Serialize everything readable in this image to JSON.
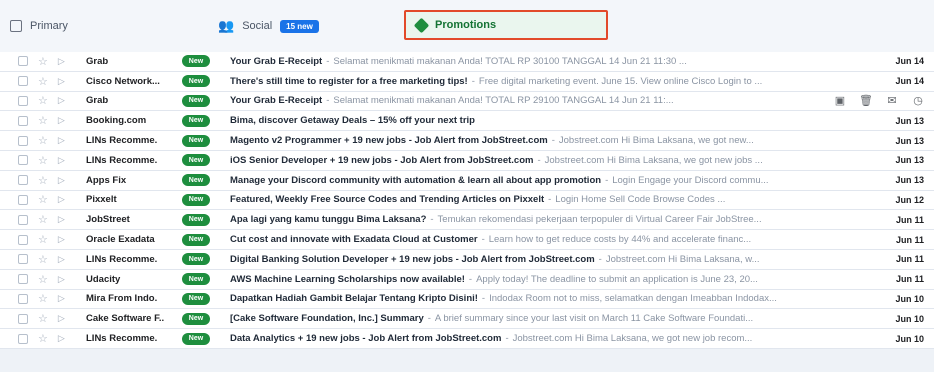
{
  "tabs": {
    "primary_label": "Primary",
    "social_label": "Social",
    "social_badge": "15 new",
    "promotions_label": "Promotions"
  },
  "rows": [
    {
      "sender": "Grab",
      "badge": "New",
      "subject": "Your Grab E-Receipt",
      "snippet": "Selamat menikmati makanan Anda! TOTAL RP 30100 TANGGAL 14 Jun 21 11:30 ...",
      "date": "Jun 14",
      "unread": true,
      "hover": false
    },
    {
      "sender": "Cisco Network...",
      "badge": "New",
      "subject": "There's still time to register for a free marketing tips!",
      "snippet": "Free digital marketing event. June 15. View online Cisco Login to ...",
      "date": "Jun 14",
      "unread": true,
      "hover": false
    },
    {
      "sender": "Grab",
      "badge": "New",
      "subject": "Your Grab E-Receipt",
      "snippet": "Selamat menikmati makanan Anda! TOTAL RP 29100 TANGGAL 14 Jun 21 11:...",
      "date": "",
      "unread": true,
      "hover": true
    },
    {
      "sender": "Booking.com",
      "badge": "New",
      "subject": "Bima, discover Getaway Deals – 15% off your next trip",
      "snippet": "",
      "date": "Jun 13",
      "unread": true,
      "hover": false
    },
    {
      "sender": "LINs Recomme.",
      "badge": "New",
      "subject": "Magento v2 Programmer + 19 new jobs - Job Alert from JobStreet.com",
      "snippet": "Jobstreet.com Hi Bima Laksana, we got new...",
      "date": "Jun 13",
      "unread": true,
      "hover": false
    },
    {
      "sender": "LINs Recomme.",
      "badge": "New",
      "subject": "iOS Senior Developer + 19 new jobs - Job Alert from JobStreet.com",
      "snippet": "Jobstreet.com Hi Bima Laksana, we got new jobs ...",
      "date": "Jun 13",
      "unread": true,
      "hover": false
    },
    {
      "sender": "Apps Fix",
      "badge": "New",
      "subject": "Manage your Discord community with automation & learn all about app promotion",
      "snippet": "Login Engage your Discord commu...",
      "date": "Jun 13",
      "unread": true,
      "hover": false
    },
    {
      "sender": "Pixxelt",
      "badge": "New",
      "subject": "Featured, Weekly Free Source Codes and Trending Articles on Pixxelt",
      "snippet": "Login Home Sell Code Browse Codes ...",
      "date": "Jun 12",
      "unread": true,
      "hover": false
    },
    {
      "sender": "JobStreet",
      "badge": "New",
      "subject": "Apa lagi yang kamu tunggu Bima Laksana?",
      "snippet": "Temukan rekomendasi pekerjaan terpopuler di Virtual Career Fair JobStree...",
      "date": "Jun 11",
      "unread": true,
      "hover": false
    },
    {
      "sender": "Oracle Exadata",
      "badge": "New",
      "subject": "Cut cost and innovate with Exadata Cloud at Customer",
      "snippet": "Learn how to get reduce costs by 44% and accelerate financ...",
      "date": "Jun 11",
      "unread": true,
      "hover": false
    },
    {
      "sender": "LINs Recomme.",
      "badge": "New",
      "subject": "Digital Banking Solution Developer + 19 new jobs - Job Alert from JobStreet.com",
      "snippet": "Jobstreet.com Hi Bima Laksana, w...",
      "date": "Jun 11",
      "unread": true,
      "hover": false
    },
    {
      "sender": "Udacity",
      "badge": "New",
      "subject": "AWS Machine Learning Scholarships now available!",
      "snippet": "Apply today! The deadline to submit an application is June 23, 20...",
      "date": "Jun 11",
      "unread": true,
      "hover": false
    },
    {
      "sender": "Mira From Indo.",
      "badge": "New",
      "subject": "Dapatkan Hadiah Gambit Belajar Tentang Kripto Disini!",
      "snippet": "Indodax Room not to miss, selamatkan dengan Imeabban Indodax...",
      "date": "Jun 10",
      "unread": true,
      "hover": false
    },
    {
      "sender": "Cake Software F..",
      "badge": "New",
      "subject": "[Cake Software Foundation, Inc.] Summary",
      "snippet": "A brief summary since your last visit on March 11 Cake Software Foundati...",
      "date": "Jun 10",
      "unread": true,
      "hover": false
    },
    {
      "sender": "LINs Recomme.",
      "badge": "New",
      "subject": "Data Analytics + 19 new jobs - Job Alert from JobStreet.com",
      "snippet": "Jobstreet.com Hi Bima Laksana, we got new job recom...",
      "date": "Jun 10",
      "unread": true,
      "hover": false
    }
  ],
  "icons": {
    "checkbox": "checkbox-icon",
    "people": "people-icon",
    "tag": "tag-icon",
    "star": "star-icon",
    "archive": "archive-icon",
    "delete": "trash-icon",
    "mark_read": "envelope-icon",
    "snooze": "clock-icon"
  },
  "colors": {
    "accent_red_box": "#e24a2a",
    "promo_green": "#1e8e3e",
    "social_blue": "#1a73e8"
  }
}
